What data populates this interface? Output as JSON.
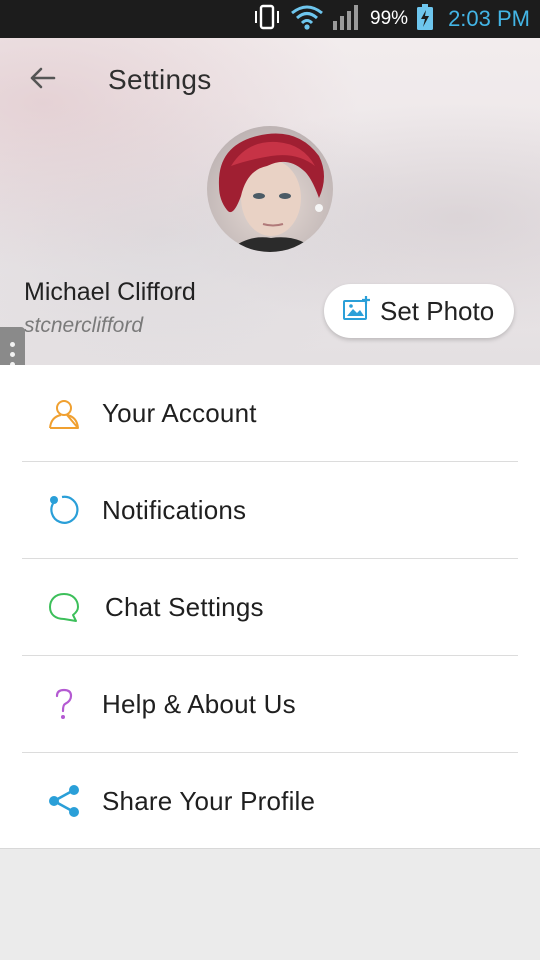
{
  "status_bar": {
    "battery_percent": "99%",
    "clock": "2:03 PM",
    "icons": [
      "vibrate-icon",
      "wifi-icon",
      "signal-icon",
      "battery-charging-icon"
    ],
    "clock_color": "#43b5e6"
  },
  "header": {
    "title": "Settings",
    "back_icon": "arrow-left-icon"
  },
  "profile": {
    "name": "Michael Clifford",
    "handle": "stcnerclifford",
    "set_photo_label": "Set Photo"
  },
  "menu": {
    "items": [
      {
        "label": "Your Account",
        "icon": "person-icon",
        "color": "#f0a030"
      },
      {
        "label": "Notifications",
        "icon": "notification-ring-icon",
        "color": "#2a9fd8"
      },
      {
        "label": "Chat Settings",
        "icon": "chat-bubble-icon",
        "color": "#3cbf5a"
      },
      {
        "label": "Help & About Us",
        "icon": "question-mark-icon",
        "color": "#b45ad2"
      },
      {
        "label": "Share Your Profile",
        "icon": "share-icon",
        "color": "#2a9fd8"
      }
    ]
  }
}
